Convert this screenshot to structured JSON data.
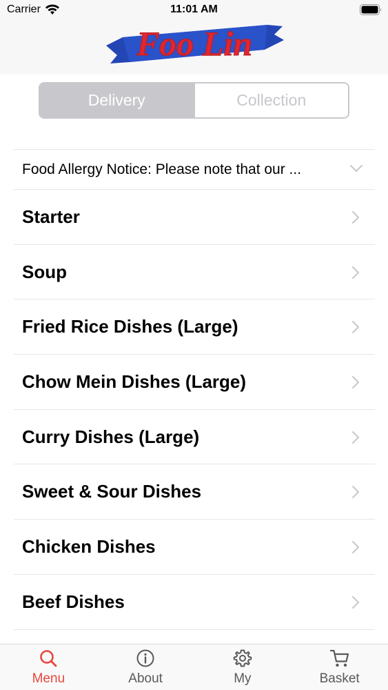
{
  "status_bar": {
    "carrier": "Carrier",
    "time": "11:01 AM"
  },
  "header": {
    "logo_text": "Foo Lin",
    "logo_colors": {
      "text": "#e0262f",
      "ribbon": "#2446b5"
    }
  },
  "order_type": {
    "options": [
      "Delivery",
      "Collection"
    ],
    "selected": "Delivery"
  },
  "notice": {
    "text": "Food Allergy Notice: Please note that our ..."
  },
  "categories": [
    {
      "label": "Starter"
    },
    {
      "label": "Soup"
    },
    {
      "label": "Fried Rice Dishes (Large)"
    },
    {
      "label": "Chow Mein Dishes (Large)"
    },
    {
      "label": "Curry Dishes (Large)"
    },
    {
      "label": "Sweet & Sour Dishes"
    },
    {
      "label": "Chicken Dishes"
    },
    {
      "label": "Beef Dishes"
    }
  ],
  "tabbar": {
    "tabs": [
      {
        "label": "Menu",
        "icon": "search-icon"
      },
      {
        "label": "About",
        "icon": "info-icon"
      },
      {
        "label": "My",
        "icon": "gear-icon"
      },
      {
        "label": "Basket",
        "icon": "cart-icon"
      }
    ],
    "active": "Menu",
    "active_color": "#e8463c"
  }
}
